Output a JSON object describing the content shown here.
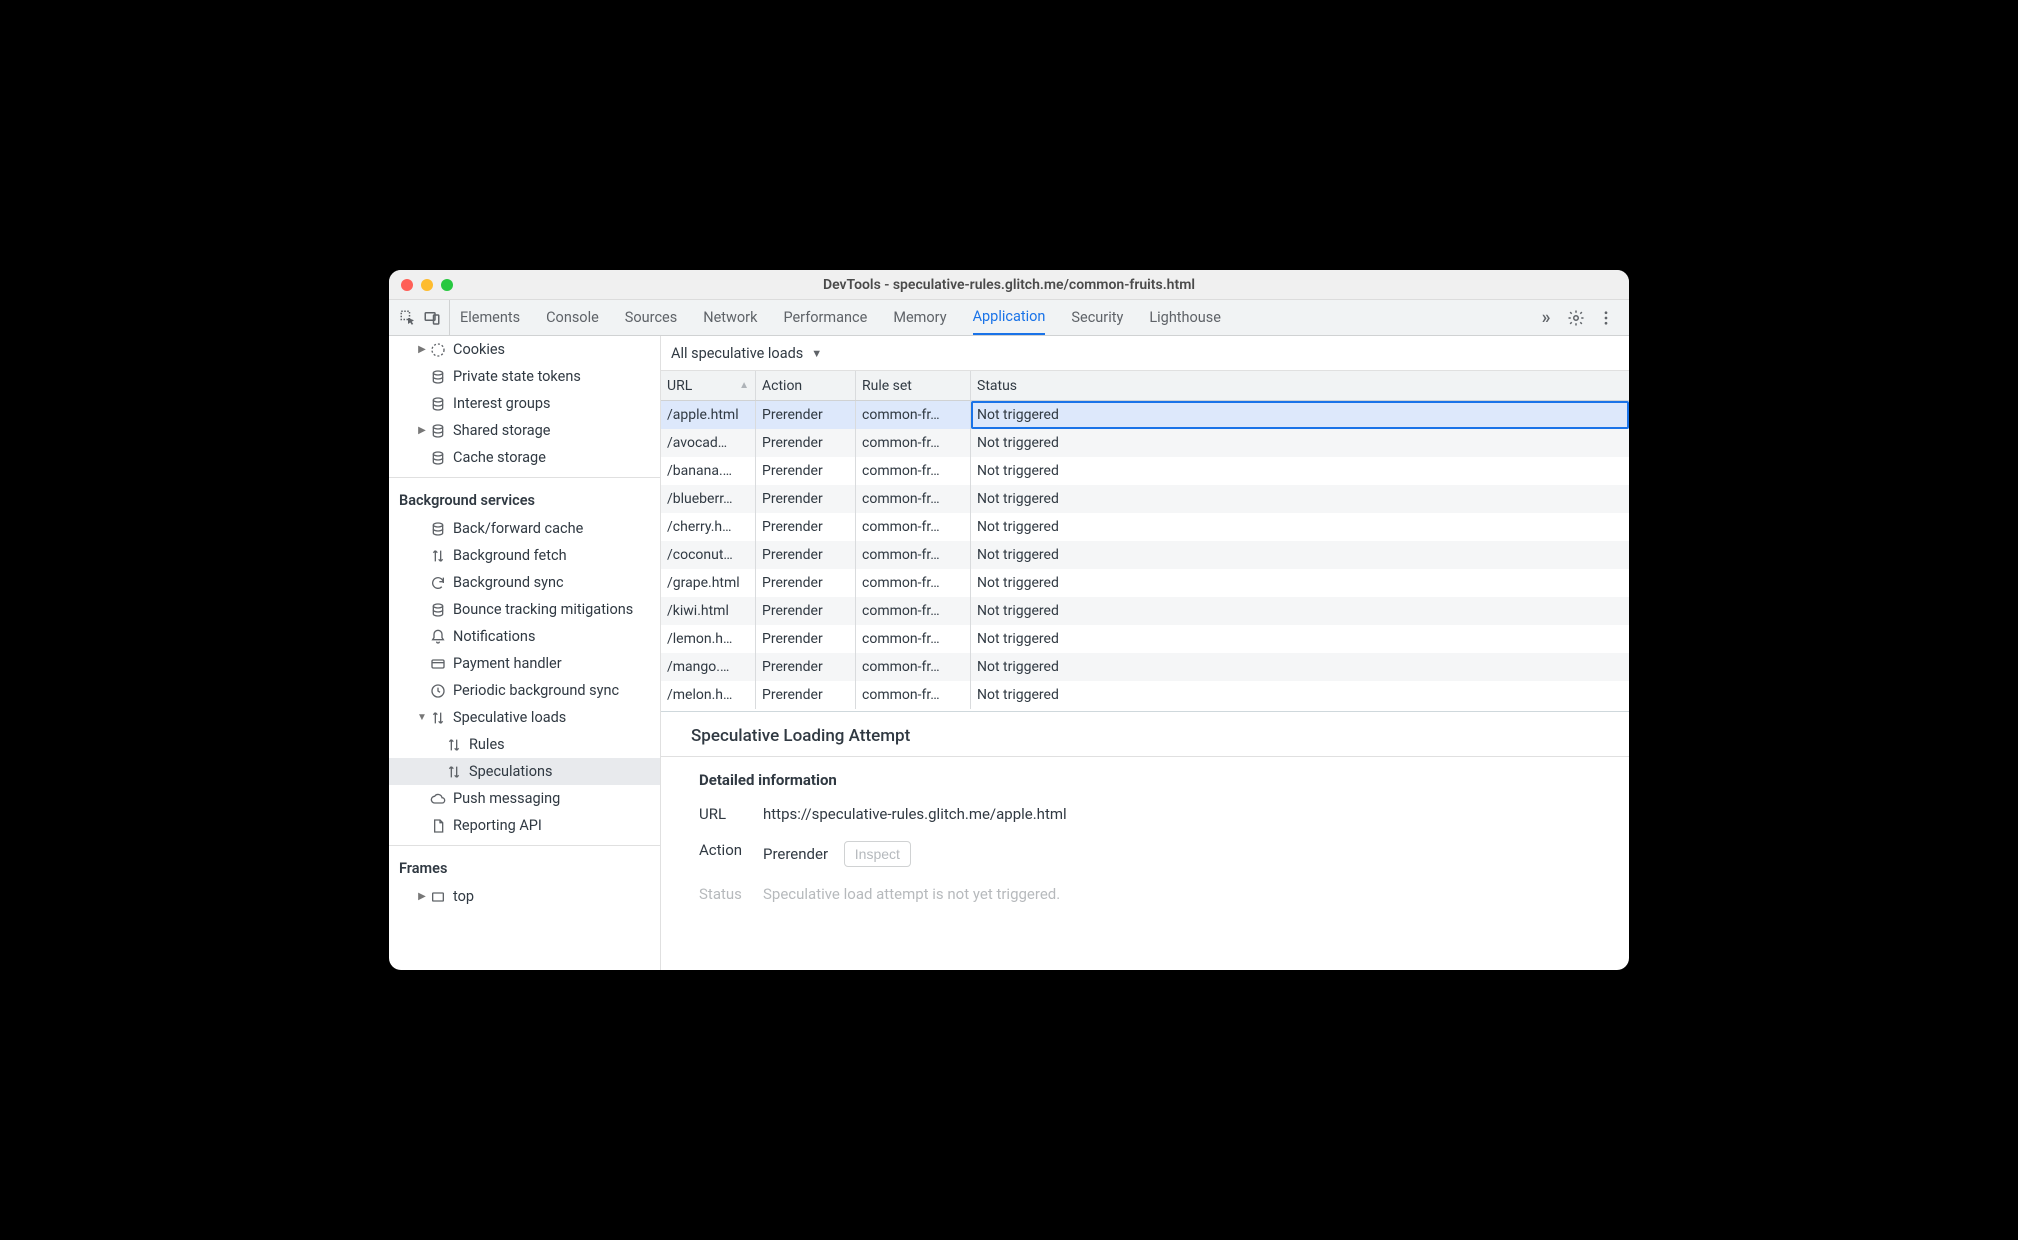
{
  "window": {
    "title": "DevTools - speculative-rules.glitch.me/common-fruits.html"
  },
  "tabs": {
    "items": [
      "Elements",
      "Console",
      "Sources",
      "Network",
      "Performance",
      "Memory",
      "Application",
      "Security",
      "Lighthouse"
    ],
    "active": "Application",
    "more_glyph": "»"
  },
  "sidebar": {
    "storage_items": [
      {
        "icon": "cookies",
        "label": "Cookies",
        "expandable": true
      },
      {
        "icon": "db",
        "label": "Private state tokens"
      },
      {
        "icon": "db",
        "label": "Interest groups"
      },
      {
        "icon": "db",
        "label": "Shared storage",
        "expandable": true
      },
      {
        "icon": "db",
        "label": "Cache storage"
      }
    ],
    "bg_header": "Background services",
    "bg_items": [
      {
        "icon": "db",
        "label": "Back/forward cache"
      },
      {
        "icon": "arrows",
        "label": "Background fetch"
      },
      {
        "icon": "sync",
        "label": "Background sync"
      },
      {
        "icon": "db",
        "label": "Bounce tracking mitigations"
      },
      {
        "icon": "bell",
        "label": "Notifications"
      },
      {
        "icon": "card",
        "label": "Payment handler"
      },
      {
        "icon": "clock",
        "label": "Periodic background sync"
      },
      {
        "icon": "arrows",
        "label": "Speculative loads",
        "expandable": true,
        "expanded": true
      },
      {
        "icon": "arrows",
        "label": "Rules",
        "indent": 1
      },
      {
        "icon": "arrows",
        "label": "Speculations",
        "indent": 1,
        "selected": true
      },
      {
        "icon": "cloud",
        "label": "Push messaging"
      },
      {
        "icon": "file",
        "label": "Reporting API"
      }
    ],
    "frames_header": "Frames",
    "frames_items": [
      {
        "icon": "frame",
        "label": "top",
        "expandable": true
      }
    ]
  },
  "filter": {
    "label": "All speculative loads"
  },
  "columns": {
    "url": "URL",
    "action": "Action",
    "ruleset": "Rule set",
    "status": "Status"
  },
  "rows": [
    {
      "url": "/apple.html",
      "url_disp": "/apple.html",
      "action": "Prerender",
      "ruleset": "common-fr…",
      "status": "Not triggered",
      "selected": true
    },
    {
      "url": "/avocado.html",
      "url_disp": "/avocad…",
      "action": "Prerender",
      "ruleset": "common-fr…",
      "status": "Not triggered"
    },
    {
      "url": "/banana.html",
      "url_disp": "/banana.…",
      "action": "Prerender",
      "ruleset": "common-fr…",
      "status": "Not triggered"
    },
    {
      "url": "/blueberry.html",
      "url_disp": "/blueberr…",
      "action": "Prerender",
      "ruleset": "common-fr…",
      "status": "Not triggered"
    },
    {
      "url": "/cherry.html",
      "url_disp": "/cherry.h…",
      "action": "Prerender",
      "ruleset": "common-fr…",
      "status": "Not triggered"
    },
    {
      "url": "/coconut.html",
      "url_disp": "/coconut…",
      "action": "Prerender",
      "ruleset": "common-fr…",
      "status": "Not triggered"
    },
    {
      "url": "/grape.html",
      "url_disp": "/grape.html",
      "action": "Prerender",
      "ruleset": "common-fr…",
      "status": "Not triggered"
    },
    {
      "url": "/kiwi.html",
      "url_disp": "/kiwi.html",
      "action": "Prerender",
      "ruleset": "common-fr…",
      "status": "Not triggered"
    },
    {
      "url": "/lemon.html",
      "url_disp": "/lemon.h…",
      "action": "Prerender",
      "ruleset": "common-fr…",
      "status": "Not triggered"
    },
    {
      "url": "/mango.html",
      "url_disp": "/mango.…",
      "action": "Prerender",
      "ruleset": "common-fr…",
      "status": "Not triggered"
    },
    {
      "url": "/melon.html",
      "url_disp": "/melon.h…",
      "action": "Prerender",
      "ruleset": "common-fr…",
      "status": "Not triggered"
    }
  ],
  "detail": {
    "heading": "Speculative Loading Attempt",
    "section": "Detailed information",
    "url_label": "URL",
    "url_value": "https://speculative-rules.glitch.me/apple.html",
    "action_label": "Action",
    "action_value": "Prerender",
    "inspect_label": "Inspect",
    "status_label": "Status",
    "status_value": "Speculative load attempt is not yet triggered."
  }
}
